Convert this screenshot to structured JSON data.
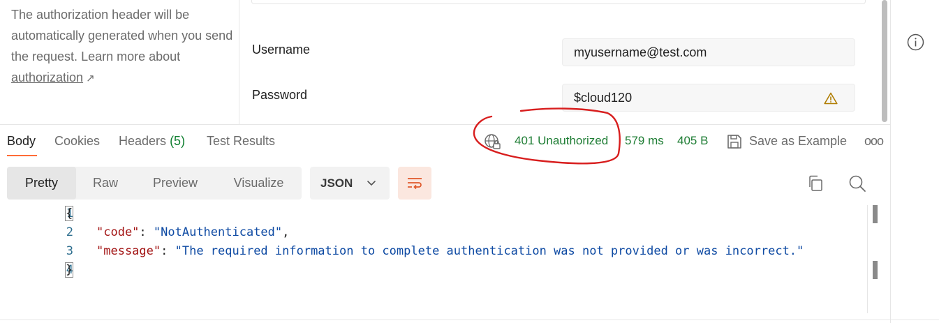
{
  "auth": {
    "help_text": "The authorization header will be automatically generated when you send the request. Learn more about",
    "help_link": "authorization",
    "help_link_icon": "external-arrow-icon",
    "username_label": "Username",
    "username_value": "myusername@test.com",
    "password_label": "Password",
    "password_value": "$cloud120",
    "password_warning_icon": "warning-icon"
  },
  "response_tabs": {
    "body": "Body",
    "cookies": "Cookies",
    "headers": "Headers",
    "headers_count": "(5)",
    "test_results": "Test Results"
  },
  "status": {
    "network_icon": "globe-lock-icon",
    "code": "401 Unauthorized",
    "time": "579 ms",
    "size": "405 B",
    "color": "#1e7d34"
  },
  "save_example": {
    "icon": "save-icon",
    "label": "Save as Example"
  },
  "view_modes": [
    "Pretty",
    "Raw",
    "Preview",
    "Visualize"
  ],
  "active_view": "Pretty",
  "format": "JSON",
  "accent_color": "#ff6c37",
  "annotation_color": "#d81e1e",
  "code_lines": [
    {
      "n": "1"
    },
    {
      "n": "2",
      "key": "\"code\"",
      "value": "\"NotAuthenticated\""
    },
    {
      "n": "3",
      "key": "\"message\"",
      "value": "\"The required information to complete authentication was not provided or was incorrect.\""
    },
    {
      "n": "4"
    }
  ]
}
